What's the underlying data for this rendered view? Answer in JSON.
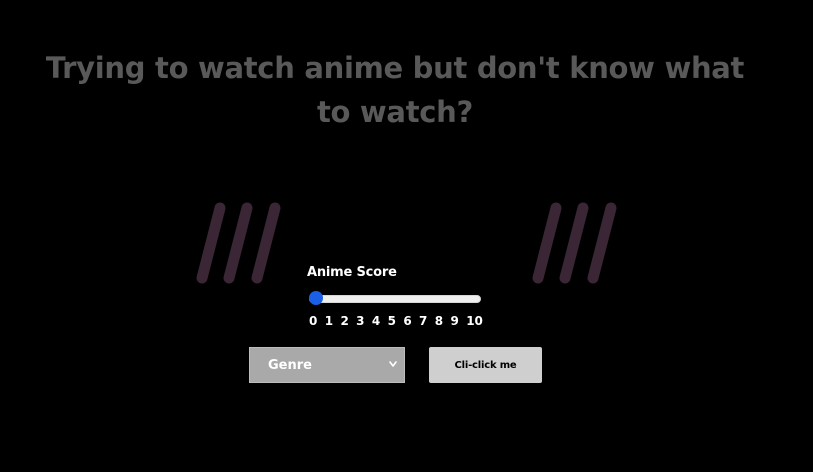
{
  "headline": "Trying to watch anime but don't know what to watch?",
  "decor": {
    "slash_color": "#3a2635",
    "icon": "triple-slash"
  },
  "score": {
    "label": "Anime Score",
    "value": 0,
    "min": 0,
    "max": 10,
    "ticks": [
      "0",
      "1",
      "2",
      "3",
      "4",
      "5",
      "6",
      "7",
      "8",
      "9",
      "10"
    ],
    "thumb_color": "#1a5fe6"
  },
  "genre": {
    "selected": "Genre"
  },
  "action": {
    "label": "Cli-click me"
  }
}
